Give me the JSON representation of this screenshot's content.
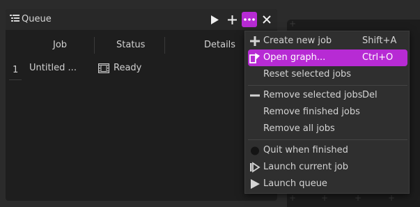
{
  "panel": {
    "title": "Queue",
    "icon": "queue-list-icon"
  },
  "toolbar": {
    "play_icon": "play-icon",
    "add_icon": "plus-icon",
    "more_icon": "more-dots-icon",
    "close_icon": "close-icon",
    "active_color": "#b72bd4"
  },
  "table": {
    "columns": [
      "Job",
      "Status",
      "Details"
    ],
    "rows": [
      {
        "index": "1",
        "job": "Untitled ...",
        "status": "Ready",
        "status_icon": "film-icon",
        "details": ""
      }
    ]
  },
  "menu": {
    "items": [
      {
        "label": "Create new job",
        "shortcut": "Shift+A",
        "icon": "plus-icon"
      },
      {
        "label": "Open graph...",
        "shortcut": "Ctrl+O",
        "icon": "open-graph-icon",
        "highlighted": true
      },
      {
        "label": "Reset selected jobs",
        "shortcut": "",
        "icon": ""
      },
      {
        "label": "Remove selected jobs",
        "shortcut": "Del",
        "icon": "minus-icon"
      },
      {
        "label": "Remove finished jobs",
        "shortcut": "",
        "icon": ""
      },
      {
        "label": "Remove all jobs",
        "shortcut": "",
        "icon": ""
      },
      {
        "label": "Quit when finished",
        "shortcut": "",
        "icon": "checkbox-icon"
      },
      {
        "label": "Launch current job",
        "shortcut": "",
        "icon": "step-forward-icon"
      },
      {
        "label": "Launch queue",
        "shortcut": "",
        "icon": "play-icon"
      }
    ]
  }
}
